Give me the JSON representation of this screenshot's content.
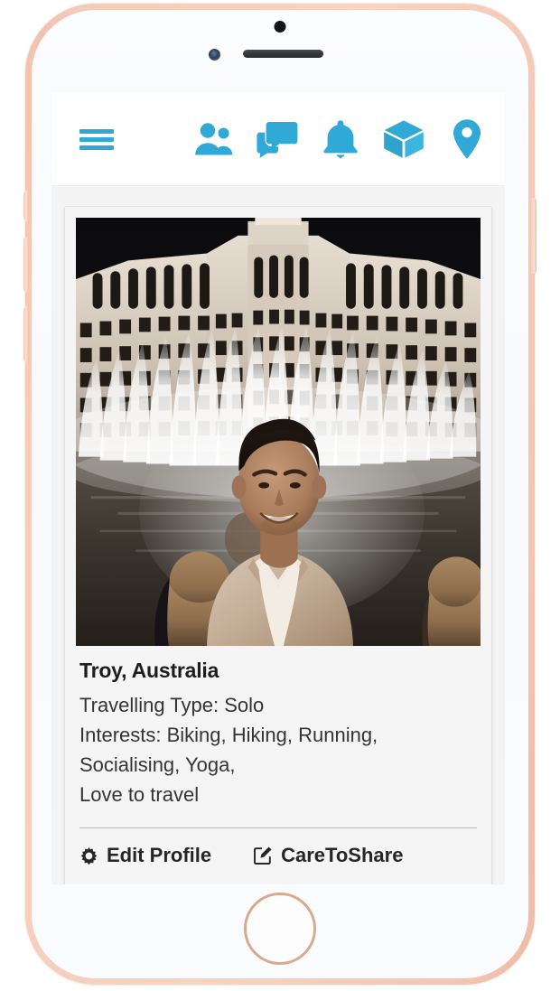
{
  "device": {
    "type": "smartphone-mockup",
    "frame_color": "#f3c9b7",
    "home_button_label": "home-button"
  },
  "theme": {
    "accent_blue": "#31a9d6",
    "card_background": "#f5f5f5",
    "screen_background": "#f4f4f4",
    "text_color": "#2e2e2e",
    "divider_color": "#b9b9b9"
  },
  "navbar": {
    "menu": {
      "icon": "hamburger-menu-icon",
      "label": "Menu"
    },
    "items": [
      {
        "icon": "people-icon",
        "label": "Friends"
      },
      {
        "icon": "chat-bubbles-icon",
        "label": "Messages"
      },
      {
        "icon": "bell-icon",
        "label": "Notifications"
      },
      {
        "icon": "cube-box-icon",
        "label": "Trips"
      },
      {
        "icon": "location-pin-icon",
        "label": "Location"
      }
    ]
  },
  "card": {
    "photo": {
      "alt": "Man in tan jacket smiling in front of the Bellagio hotel fountains at night",
      "scene": "bellagio-fountains-night"
    },
    "profile_name": "Troy, Australia",
    "details": [
      "Travelling Type: Solo",
      "Interests: Biking, Hiking, Running,",
      "Socialising, Yoga,",
      "Love to travel"
    ],
    "footer": {
      "edit_profile": {
        "icon": "gear-icon",
        "label": "Edit Profile"
      },
      "care_to_share": {
        "icon": "pencil-square-icon",
        "label": "CareToShare"
      }
    }
  }
}
